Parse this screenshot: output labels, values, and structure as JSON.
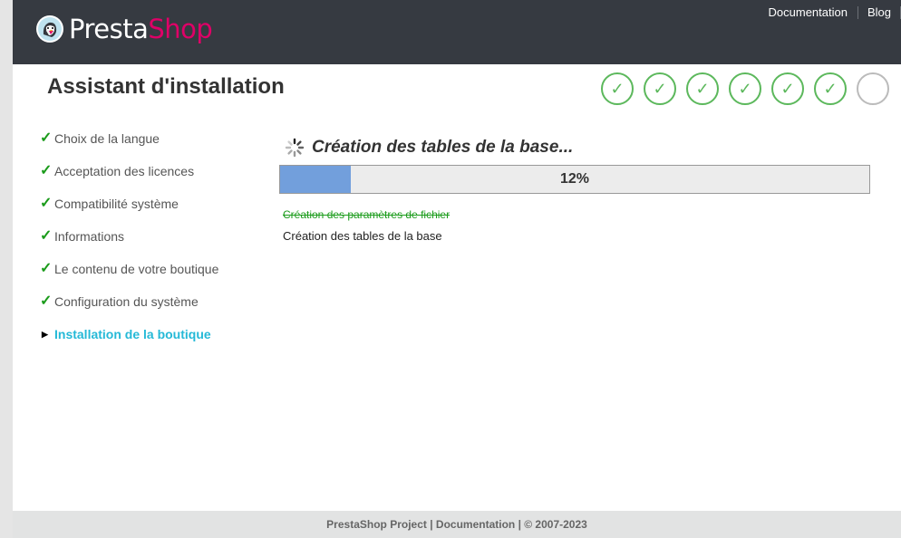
{
  "header": {
    "logo": {
      "presta": "Presta",
      "shop": "Shop",
      "icon": "puffin-logo-icon"
    },
    "nav": [
      {
        "label": "Documentation"
      },
      {
        "label": "Blog"
      }
    ]
  },
  "title": "Assistant d'installation",
  "progress_steps": {
    "total": 7,
    "completed": 6,
    "check_glyph": "✓"
  },
  "sidebar": {
    "items": [
      {
        "label": "Choix de la langue",
        "status": "done",
        "mark": "✓"
      },
      {
        "label": "Acceptation des licences",
        "status": "done",
        "mark": "✓"
      },
      {
        "label": "Compatibilité système",
        "status": "done",
        "mark": "✓"
      },
      {
        "label": "Informations",
        "status": "done",
        "mark": "✓"
      },
      {
        "label": "Le contenu de votre boutique",
        "status": "done",
        "mark": "✓"
      },
      {
        "label": "Configuration du système",
        "status": "done",
        "mark": "✓"
      },
      {
        "label": "Installation de la boutique",
        "status": "active",
        "mark": "▶"
      }
    ]
  },
  "install": {
    "heading": "Création des tables de la base...",
    "progress_percent": 12,
    "progress_label": "12%",
    "log": [
      {
        "text": "Création des paramètres de fichier",
        "state": "done"
      },
      {
        "text": "Création des tables de la base",
        "state": "current"
      }
    ]
  },
  "footer": {
    "text": "PrestaShop Project | Documentation | © 2007-2023"
  },
  "colors": {
    "header_bg": "#363a41",
    "accent_pink": "#df0067",
    "active_blue": "#25b9d7",
    "success_green": "#5cb85c",
    "progress_fill": "#729fdc"
  }
}
